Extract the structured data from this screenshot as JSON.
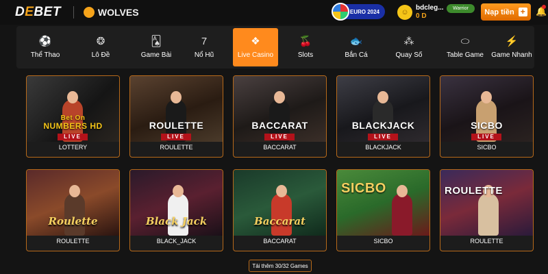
{
  "header": {
    "logo": {
      "prefix": "D",
      "accent": "E",
      "suffix": "BET"
    },
    "partner": "WOLVES",
    "euro_badge": "EURO 2024",
    "user": {
      "avatar": "☺",
      "name": "bdcleg...",
      "balance": "0 D",
      "rank": "Warrior"
    },
    "deposit_label": "Nạp tiền",
    "deposit_icon": "plus-icon",
    "bell_icon": "bell-icon"
  },
  "nav": {
    "items": [
      {
        "label": "Thể Thao",
        "icon": "⚽"
      },
      {
        "label": "Lô Đề",
        "icon": "❂"
      },
      {
        "label": "Game Bài",
        "icon": "🂡"
      },
      {
        "label": "Nổ Hũ",
        "icon": "7"
      },
      {
        "label": "Live Casino",
        "icon": "❖"
      },
      {
        "label": "Slots",
        "icon": "🍒"
      },
      {
        "label": "Bắn Cá",
        "icon": "🐟"
      },
      {
        "label": "Quay Số",
        "icon": "⁂"
      },
      {
        "label": "Table Game",
        "icon": "⬭"
      },
      {
        "label": "Game Nhanh",
        "icon": "⚡"
      }
    ],
    "active_index": 4
  },
  "games": [
    {
      "label": "LOTTERY",
      "art_top": "Bet On",
      "art_main": "NUMBERS HD",
      "art_sub": "LIVE",
      "style": "plain"
    },
    {
      "label": "ROULETTE",
      "art_main": "ROULETTE",
      "art_sub": "LIVE",
      "style": "plain"
    },
    {
      "label": "BACCARAT",
      "art_main": "BACCARAT",
      "art_sub": "LIVE",
      "style": "plain"
    },
    {
      "label": "BLACKJACK",
      "art_main": "BLACKJACK",
      "art_sub": "LIVE",
      "style": "plain"
    },
    {
      "label": "SICBO",
      "art_main": "SICBO",
      "art_sub": "LIVE",
      "style": "plain"
    },
    {
      "label": "ROULETTE",
      "art_main": "Roulette",
      "style": "fancy"
    },
    {
      "label": "BLACK_JACK",
      "art_main": "Black Jack",
      "style": "fancy"
    },
    {
      "label": "BACCARAT",
      "art_main": "Baccarat",
      "style": "fancy"
    },
    {
      "label": "SICBO",
      "art_main": "SICBO",
      "style": "bold"
    },
    {
      "label": "ROULETTE",
      "art_main": "ROULETTE",
      "style": "bold"
    }
  ],
  "load_more": "Tải thêm 30/32 Games",
  "colors": {
    "accent": "#ff8a1d",
    "card_border": "#b86a1a",
    "background": "#141414"
  }
}
